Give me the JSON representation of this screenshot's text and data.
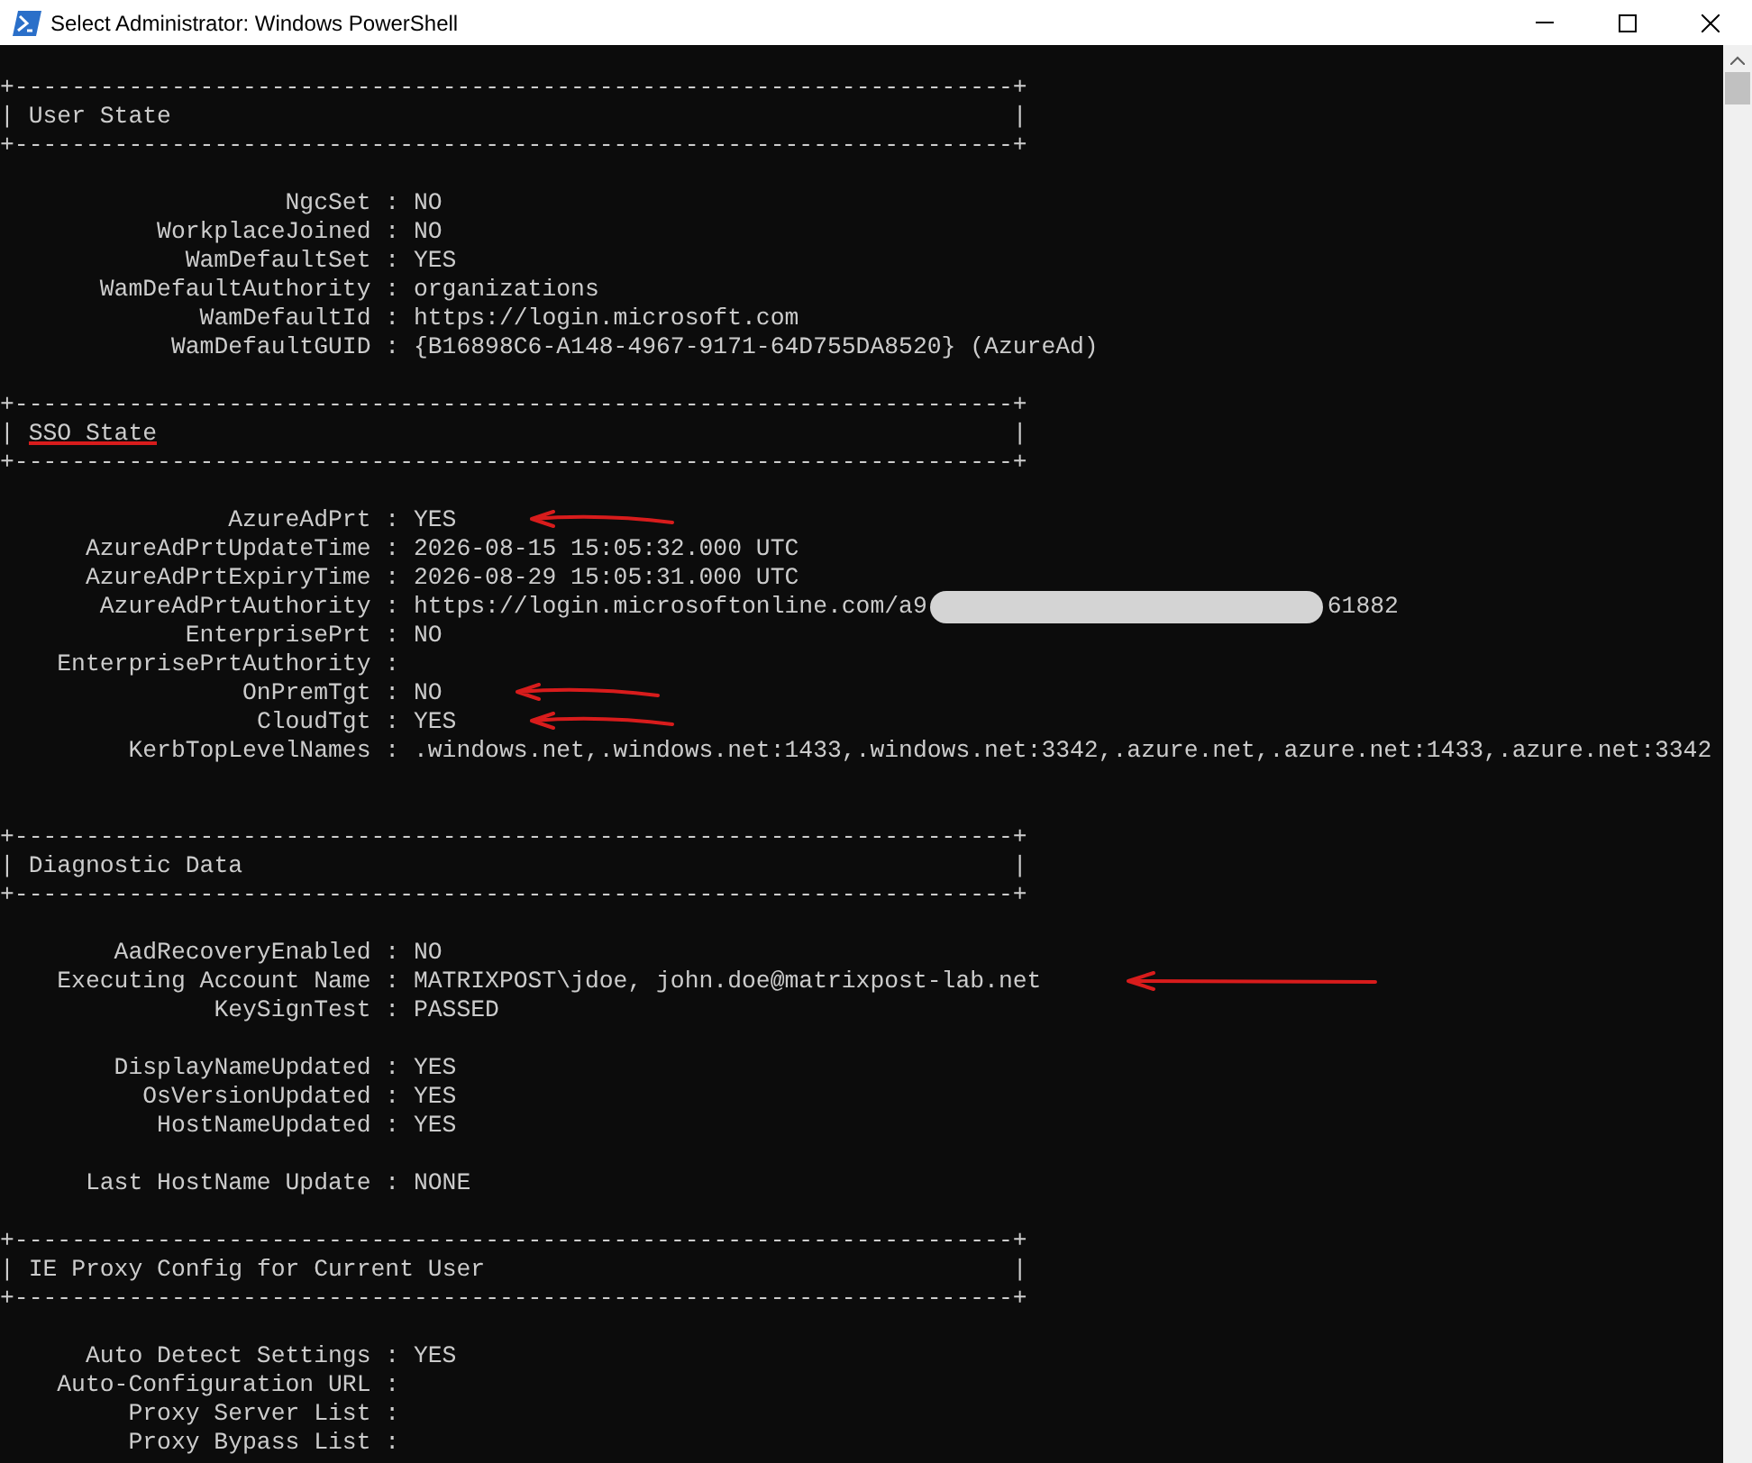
{
  "window": {
    "title": "Select Administrator: Windows PowerShell"
  },
  "sections": [
    {
      "border_top": "+----------------------------------------------------------------------+",
      "edge_left": "|",
      "title": "User State",
      "edge_right": "|",
      "border_bottom": "+----------------------------------------------------------------------+",
      "underlined": false,
      "groups": [
        {
          "rows": [
            {
              "key": "NgcSet :",
              "value": "NO",
              "annotated": false
            },
            {
              "key": "WorkplaceJoined :",
              "value": "NO",
              "annotated": false
            },
            {
              "key": "WamDefaultSet :",
              "value": "YES",
              "annotated": false
            },
            {
              "key": "WamDefaultAuthority :",
              "value": "organizations",
              "annotated": false
            },
            {
              "key": "WamDefaultId :",
              "value": "https://login.microsoft.com",
              "annotated": false
            },
            {
              "key": "WamDefaultGUID :",
              "value": "{B16898C6-A148-4967-9171-64D755DA8520} (AzureAd)",
              "annotated": false
            }
          ]
        }
      ]
    },
    {
      "border_top": "+----------------------------------------------------------------------+",
      "edge_left": "|",
      "title": "SSO State",
      "edge_right": "|",
      "border_bottom": "+----------------------------------------------------------------------+",
      "underlined": true,
      "groups": [
        {
          "rows": [
            {
              "key": "AzureAdPrt :",
              "value": "YES",
              "annotated": true
            },
            {
              "key": "AzureAdPrtUpdateTime :",
              "value": "2026-08-15 15:05:32.000 UTC",
              "annotated": false
            },
            {
              "key": "AzureAdPrtExpiryTime :",
              "value": "2026-08-29 15:05:31.000 UTC",
              "annotated": false
            },
            {
              "key": "AzureAdPrtAuthority :",
              "value": "https://login.microsoftonline.com/a9",
              "redacted": true,
              "value_end": "61882",
              "annotated": false
            },
            {
              "key": "EnterprisePrt :",
              "value": "NO",
              "annotated": false
            },
            {
              "key": "EnterprisePrtAuthority :",
              "value": "",
              "annotated": false
            },
            {
              "key": "OnPremTgt :",
              "value": "NO",
              "annotated": true
            },
            {
              "key": "CloudTgt :",
              "value": "YES",
              "annotated": true
            },
            {
              "key": "KerbTopLevelNames :",
              "value": ".windows.net,.windows.net:1433,.windows.net:3342,.azure.net,.azure.net:1433,.azure.net:3342",
              "annotated": false
            }
          ]
        }
      ]
    },
    {
      "border_top": "+----------------------------------------------------------------------+",
      "edge_left": "|",
      "title": "Diagnostic Data",
      "edge_right": "|",
      "border_bottom": "+----------------------------------------------------------------------+",
      "underlined": false,
      "groups": [
        {
          "rows": [
            {
              "key": "AadRecoveryEnabled :",
              "value": "NO",
              "annotated": false
            },
            {
              "key": "Executing Account Name :",
              "value": "MATRIXPOST\\jdoe, john.doe@matrixpost-lab.net",
              "annotated": true
            },
            {
              "key": "KeySignTest :",
              "value": "PASSED",
              "annotated": false
            }
          ]
        },
        {
          "rows": [
            {
              "key": "DisplayNameUpdated :",
              "value": "YES",
              "annotated": false
            },
            {
              "key": "OsVersionUpdated :",
              "value": "YES",
              "annotated": false
            },
            {
              "key": "HostNameUpdated :",
              "value": "YES",
              "annotated": false
            }
          ]
        },
        {
          "rows": [
            {
              "key": "Last HostName Update :",
              "value": "NONE",
              "annotated": false
            }
          ]
        }
      ]
    },
    {
      "border_top": "+----------------------------------------------------------------------+",
      "edge_left": "|",
      "title": "IE Proxy Config for Current User",
      "edge_right": "|",
      "border_bottom": "+----------------------------------------------------------------------+",
      "underlined": false,
      "groups": [
        {
          "rows": [
            {
              "key": "Auto Detect Settings :",
              "value": "YES",
              "annotated": false
            },
            {
              "key": "Auto-Configuration URL :",
              "value": "",
              "annotated": false
            },
            {
              "key": "Proxy Server List :",
              "value": "",
              "annotated": false
            },
            {
              "key": "Proxy Bypass List :",
              "value": "",
              "annotated": false
            }
          ]
        }
      ]
    }
  ]
}
